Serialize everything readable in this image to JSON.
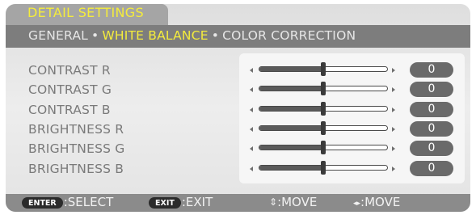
{
  "menu_title": "DETAIL SETTINGS",
  "tabs": [
    {
      "label": "GENERAL"
    },
    {
      "label": "WHITE BALANCE",
      "active": true
    },
    {
      "label": "COLOR CORRECTION"
    }
  ],
  "tab_separator": "•",
  "rows": [
    {
      "label": "CONTRAST R",
      "value": "0",
      "level": 0.5
    },
    {
      "label": "CONTRAST G",
      "value": "0",
      "level": 0.5
    },
    {
      "label": "CONTRAST B",
      "value": "0",
      "level": 0.5
    },
    {
      "label": "BRIGHTNESS R",
      "value": "0",
      "level": 0.5
    },
    {
      "label": "BRIGHTNESS G",
      "value": "0",
      "level": 0.5
    },
    {
      "label": "BRIGHTNESS B",
      "value": "0",
      "level": 0.5
    }
  ],
  "footer": {
    "enter_key": "ENTER",
    "enter_label": ":SELECT",
    "exit_key": "EXIT",
    "exit_label": ":EXIT",
    "move_vertical_glyph": "⇕",
    "move_vertical_label": ":MOVE",
    "move_horizontal_glyph": "◂▸",
    "move_horizontal_label": ":MOVE"
  },
  "colors": {
    "accent": "#f4ec3c",
    "tab_bar": "#7d7d7d",
    "footer": "#8b8b8b",
    "value_pill": "#6a6a6a"
  },
  "icons": {
    "slider_left": "arrow-left-icon",
    "slider_right": "arrow-right-icon",
    "vertical_move": "up-down-arrow-icon",
    "horizontal_move": "left-right-arrow-icon"
  }
}
